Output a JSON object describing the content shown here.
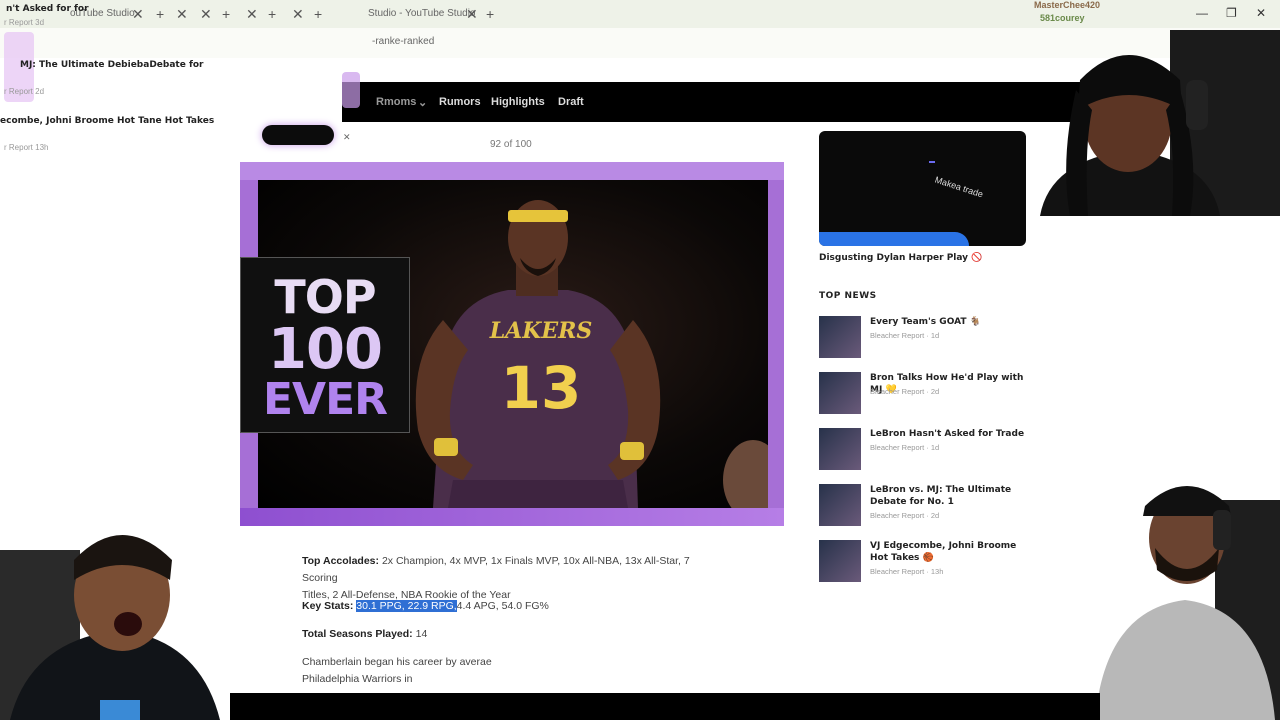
{
  "browser": {
    "tabs": [
      "n't Asked for for",
      "ouTube Studio",
      "Studio - YouTube Studio"
    ],
    "address": "-ranke-ranked",
    "window_controls": [
      "—",
      "❐",
      "✕"
    ]
  },
  "ghost_sidebar": {
    "items": [
      {
        "title": "n't Asked for for",
        "meta": "r Report 3d"
      },
      {
        "title": "MJ: The Ultimate DebiebaDebate for",
        "meta": "r Report 2d"
      },
      {
        "title": "ecombe, Johni Broome Hot Tane Hot Takes",
        "meta": "r Report 13h"
      }
    ]
  },
  "site_nav": {
    "items": [
      "Rmoms",
      "Rumors",
      "Highlights",
      "Draft"
    ]
  },
  "article": {
    "counter": "92 of 100",
    "hero": {
      "badge_line1": "TOP",
      "badge_line2": "100",
      "badge_line3": "EVER",
      "jersey_team": "LAKERS",
      "jersey_number": "13"
    },
    "accolades_label": "Top Accolades:",
    "accolades_line1": "2x Champion, 4x MVP, 1x Finals MVP, 10x All-NBA, 13x All-Star, 7 Scoring",
    "accolades_line2": "Titles, 2 All-Defense, NBA Rookie of the Year",
    "keystats_label": "Key Stats:",
    "keystats_highlighted": "30.1 PPG, 22.9 RPG,",
    "keystats_rest": "4.4 APG, 54.0 FG%",
    "seasons_label": "Total Seasons Played:",
    "seasons_value": "14",
    "body_line1": "Chamberlain began his career by averae",
    "body_line2": "Philadelphia Warriors in"
  },
  "right_col": {
    "video_overlay_text": "Makea trade",
    "video_title": "Disgusting Dylan Harper Play 🚫",
    "top_news_heading": "TOP NEWS",
    "news": [
      {
        "title": "Every Team's GOAT 🐐",
        "source": "Bleacher Report · 1d"
      },
      {
        "title": "Bron Talks How He'd Play with MJ 💛",
        "source": "Bleacher Report · 2d"
      },
      {
        "title": "LeBron Hasn't Asked for Trade",
        "source": "Bleacher Report · 1d"
      },
      {
        "title": "LeBron vs. MJ: The Ultimate Debate for No. 1",
        "source": "Bleacher Report · 2d"
      },
      {
        "title": "VJ Edgecombe, Johni Broome Hot Takes 🏀",
        "source": "Bleacher Report · 13h"
      }
    ]
  },
  "stream_overlay": {
    "chat_names": [
      "MasterChee420",
      "581courey"
    ]
  },
  "colors": {
    "hero_purple": "#a66fd6",
    "highlight_blue": "#2f6fd4",
    "nav_black": "#000000"
  }
}
